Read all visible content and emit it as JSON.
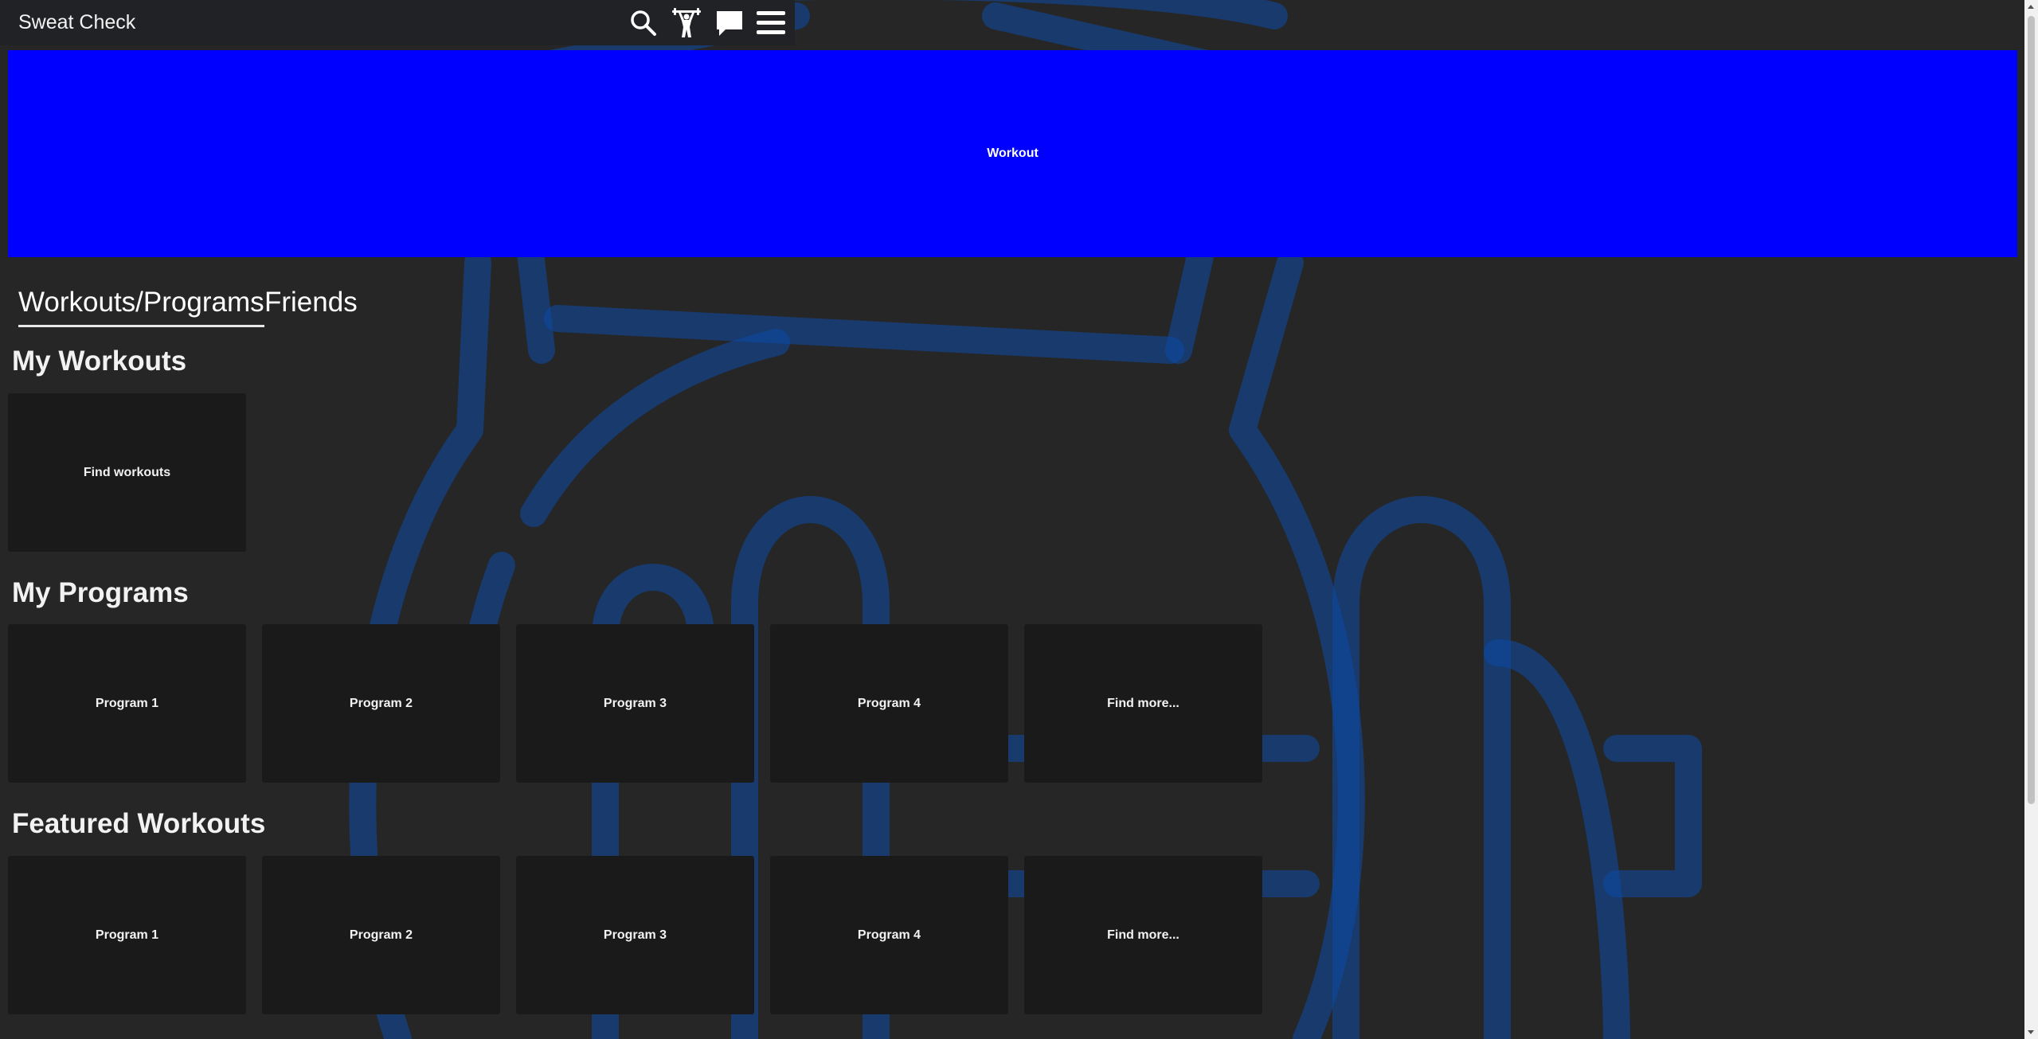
{
  "app": {
    "title": "Sweat Check"
  },
  "nav": {
    "icons": [
      {
        "name": "search-icon"
      },
      {
        "name": "weightlifter-icon"
      },
      {
        "name": "chat-icon"
      },
      {
        "name": "menu-icon"
      }
    ]
  },
  "banner": {
    "label": "Workout",
    "color": "#0000ff"
  },
  "tabs": [
    {
      "label": "Workouts/Programs",
      "active": true
    },
    {
      "label": "Friends",
      "active": false
    }
  ],
  "sections": {
    "my_workouts": {
      "title": "My Workouts",
      "cards": [
        "Find workouts"
      ]
    },
    "my_programs": {
      "title": "My Programs",
      "cards": [
        "Program 1",
        "Program 2",
        "Program 3",
        "Program 4",
        "Find more..."
      ]
    },
    "featured_workouts": {
      "title": "Featured Workouts",
      "cards": [
        "Program 1",
        "Program 2",
        "Program 3",
        "Program 4",
        "Find more..."
      ]
    }
  },
  "colors": {
    "background": "#262626",
    "topbar": "#202225",
    "card": "#1a1a1a",
    "watermark": "#0d4aa8"
  }
}
